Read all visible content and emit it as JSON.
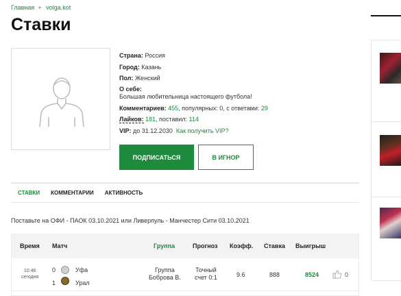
{
  "breadcrumb": {
    "home": "Главная",
    "user": "volga.kot"
  },
  "page_title": "Ставки",
  "profile": {
    "country_label": "Страна:",
    "country": "Россия",
    "city_label": "Город:",
    "city": "Казань",
    "gender_label": "Пол:",
    "gender": "Женский",
    "about_label": "О себе:",
    "about": "Большая любительница настоящего футбола!",
    "comments_label": "Комментариев:",
    "comments_count": "455",
    "comments_popular": ", популярных: 0, с ответами:",
    "comments_replies": "29",
    "likes_label": "Лайков:",
    "likes_count": "181",
    "likes_given_text": ", поставил:",
    "likes_given": "114",
    "vip_label": "VIP:",
    "vip_until": "до 31.12.2030",
    "vip_link": "Как получить VIP?"
  },
  "buttons": {
    "subscribe": "ПОДПИСАТЬСЯ",
    "ignore": "В ИГНОР"
  },
  "tabs": [
    {
      "label": "СТАВКИ"
    },
    {
      "label": "КОММЕНТАРИИ"
    },
    {
      "label": "АКТИВНОСТЬ"
    }
  ],
  "offer_text": "Поставьте на ОФИ - ПАОК 03.10.2021 или Ливерпуль - Манчестер Сити 03.10.2021",
  "table": {
    "headers": {
      "time": "Время",
      "match": "Матч",
      "group": "Группа",
      "forecast": "Прогноз",
      "coef": "Коэфф.",
      "stake": "Ставка",
      "win": "Выигрыш"
    },
    "rows": [
      {
        "time": "10:46",
        "date": "сегодня",
        "score1": "0",
        "team1": "Уфа",
        "score2": "1",
        "team2": "Урал",
        "group_line1": "Группа",
        "group_line2": "Боброва В.",
        "forecast_line1": "Точный",
        "forecast_line2": "счет 0:1",
        "coef": "9.6",
        "stake": "888",
        "win": "8524",
        "likes": "0"
      }
    ]
  },
  "colors": {
    "accent": "#1e8a3c"
  }
}
